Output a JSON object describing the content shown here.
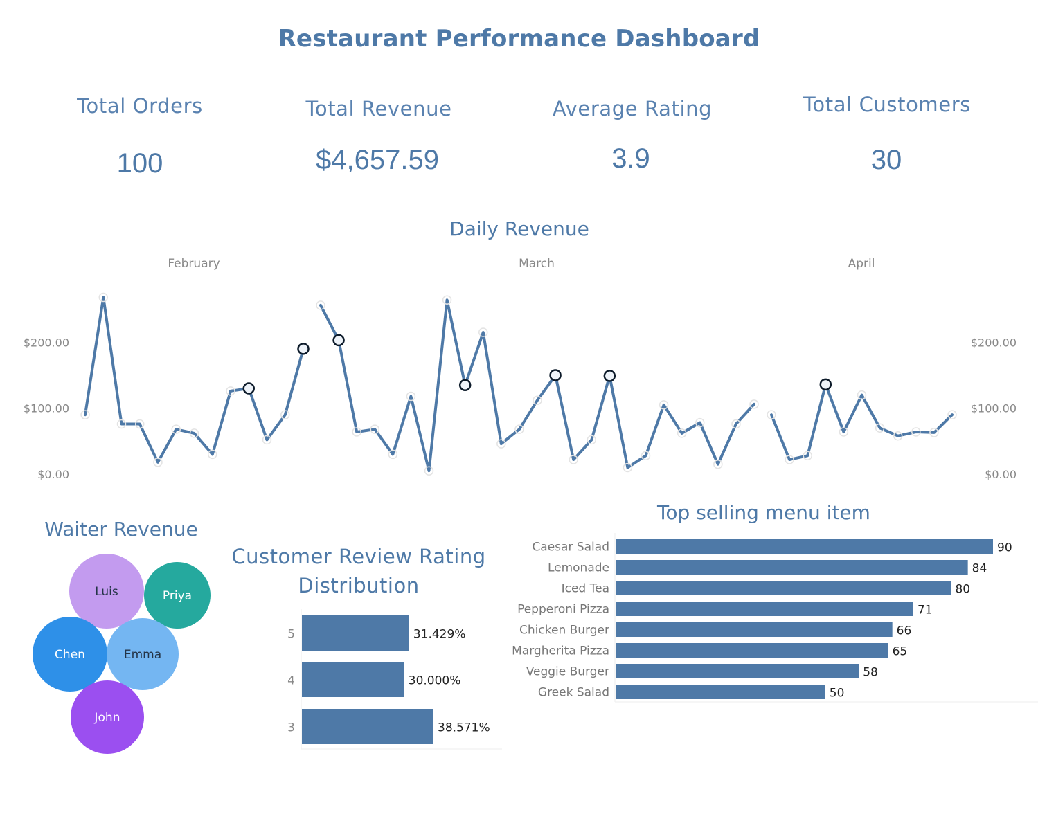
{
  "dashboard": {
    "title": "Restaurant Performance Dashboard"
  },
  "kpis": [
    {
      "label": "Total Orders",
      "value": "100"
    },
    {
      "label": "Total Revenue",
      "value": "$4,657.59"
    },
    {
      "label": "Average Rating",
      "value": "3.9"
    },
    {
      "label": "Total Customers",
      "value": "30"
    }
  ],
  "colors": {
    "primary": "#4e79a7",
    "axis_text": "#888888",
    "bar": "#4e79a7"
  },
  "chart_data": [
    {
      "type": "line",
      "title": "Daily Revenue",
      "panels": [
        {
          "name": "February",
          "values": [
            90,
            268,
            76,
            76,
            18,
            68,
            62,
            30,
            126,
            130,
            52,
            90,
            190
          ],
          "highlighted": [
            false,
            false,
            false,
            false,
            false,
            false,
            false,
            false,
            false,
            true,
            false,
            false,
            true
          ]
        },
        {
          "name": "March",
          "values": [
            256,
            203,
            64,
            68,
            30,
            118,
            5,
            264,
            135,
            215,
            46,
            68,
            112,
            150,
            22,
            52,
            149,
            10,
            28,
            105,
            62,
            78,
            15,
            76,
            106
          ],
          "highlighted": [
            false,
            true,
            false,
            false,
            false,
            false,
            false,
            false,
            true,
            false,
            false,
            false,
            false,
            true,
            false,
            false,
            true,
            false,
            false,
            false,
            false,
            false,
            false,
            false,
            false
          ]
        },
        {
          "name": "April",
          "values": [
            90,
            22,
            28,
            136,
            64,
            120,
            70,
            58,
            64,
            63,
            90
          ],
          "highlighted": [
            false,
            false,
            false,
            true,
            false,
            false,
            false,
            false,
            false,
            false,
            false
          ]
        }
      ],
      "yticks": [
        "$0.00",
        "$100.00",
        "$200.00"
      ],
      "ylim": [
        0,
        280
      ]
    },
    {
      "type": "bubble",
      "title": "Waiter Revenue",
      "items": [
        {
          "name": "Luis",
          "color": "#c39bef"
        },
        {
          "name": "Priya",
          "color": "#25a99e"
        },
        {
          "name": "Chen",
          "color": "#2e90e8"
        },
        {
          "name": "Emma",
          "color": "#74b6f2"
        },
        {
          "name": "John",
          "color": "#9b4ff0"
        }
      ]
    },
    {
      "type": "bar",
      "title": "Customer Review Rating Distribution",
      "title_line1": "Customer Review Rating",
      "title_line2": "Distribution",
      "categories": [
        "5",
        "4",
        "3"
      ],
      "values": [
        31.429,
        30.0,
        38.571
      ],
      "labels": [
        "31.429%",
        "30.000%",
        "38.571%"
      ]
    },
    {
      "type": "bar",
      "title": "Top selling menu item",
      "categories": [
        "Caesar Salad",
        "Lemonade",
        "Iced Tea",
        "Pepperoni Pizza",
        "Chicken Burger",
        "Margherita Pizza",
        "Veggie Burger",
        "Greek Salad"
      ],
      "values": [
        90,
        84,
        80,
        71,
        66,
        65,
        58,
        50
      ]
    }
  ]
}
